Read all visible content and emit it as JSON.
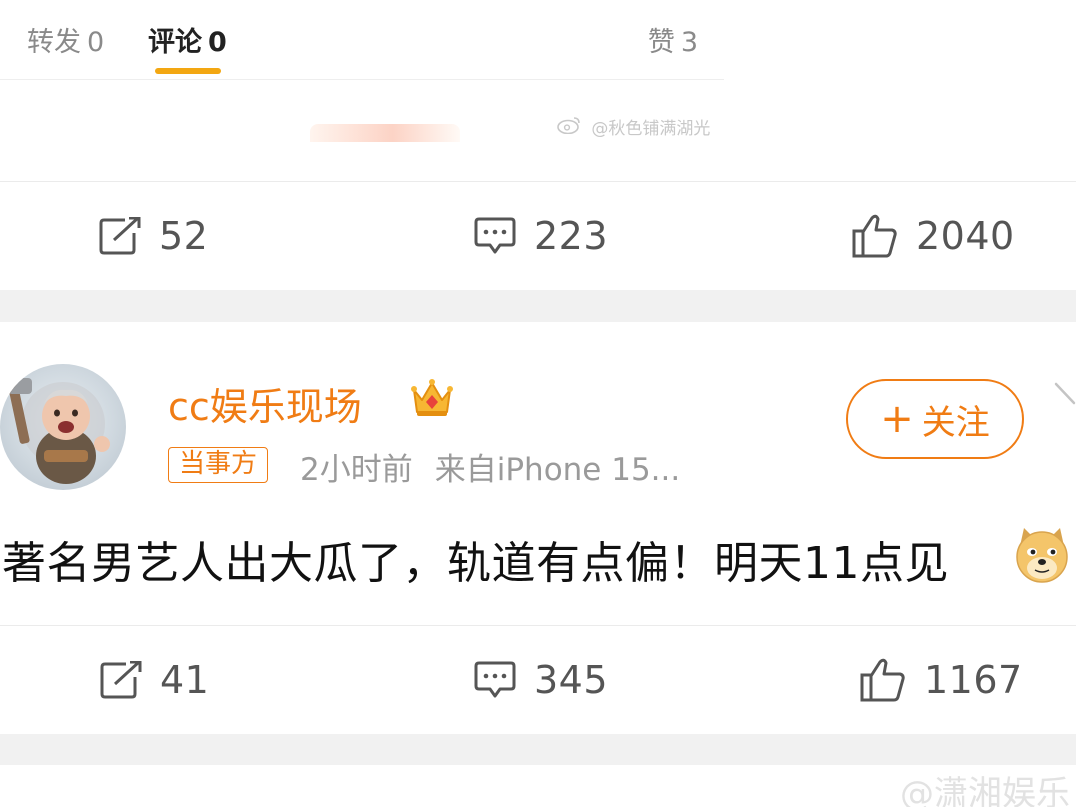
{
  "top_tabs": {
    "repost": {
      "label": "转发",
      "count": "0"
    },
    "comment": {
      "label": "评论",
      "count": "0"
    },
    "like": {
      "label": "赞",
      "count": "3"
    },
    "watermark": "@秋色铺满湖光"
  },
  "post1_actions": {
    "repost_count": "52",
    "comment_count": "223",
    "like_count": "2040"
  },
  "post": {
    "author": "cc娱乐现场",
    "role_badge": "当事方",
    "time": "2小时前",
    "source": "来自iPhone 15...",
    "follow_label": "关注",
    "follow_plus": "+",
    "text": "著名男艺人出大瓜了，轨道有点偏！明天11点见"
  },
  "post2_actions": {
    "repost_count": "41",
    "comment_count": "345",
    "like_count": "1167"
  },
  "bottom_watermark": "@潇湘娱乐",
  "icons": [
    "repost-icon",
    "comment-icon",
    "like-icon",
    "vip-crown-icon",
    "doge-emoji-icon",
    "chevron-right-icon",
    "weibo-logo-icon"
  ],
  "colors": {
    "accent": "#f07c14",
    "tab_underline": "#f3a712",
    "gap": "#f1f1f1"
  }
}
